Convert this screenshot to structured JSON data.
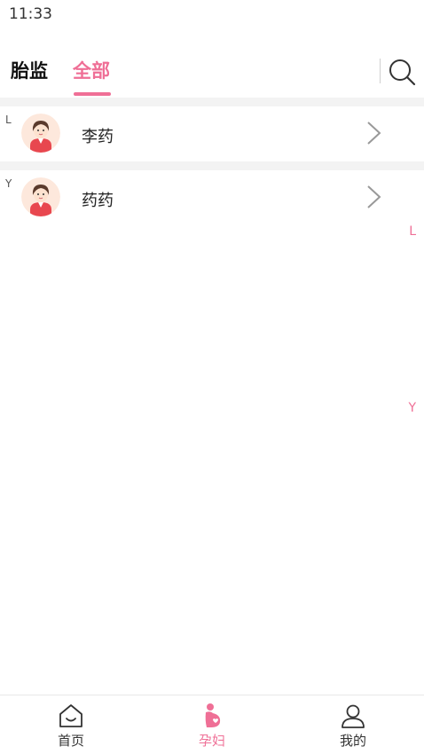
{
  "status_bar": {
    "time": "11:33"
  },
  "header": {
    "tabs": [
      {
        "label": "胎监",
        "active": false
      },
      {
        "label": "全部",
        "active": true
      }
    ],
    "search_icon": "search-icon"
  },
  "contacts": [
    {
      "group": "L",
      "name": "李药",
      "avatar_icon": "female-avatar-icon"
    },
    {
      "group": "Y",
      "name": "药药",
      "avatar_icon": "female-avatar-icon"
    }
  ],
  "index_bar": [
    "L",
    "Y"
  ],
  "bottom_nav": {
    "items": [
      {
        "label": "首页",
        "icon": "home-icon",
        "active": false
      },
      {
        "label": "孕妇",
        "icon": "pregnant-woman-icon",
        "active": true
      },
      {
        "label": "我的",
        "icon": "user-icon",
        "active": false
      }
    ]
  },
  "colors": {
    "accent": "#ef6f96",
    "separator": "#f3f3f3",
    "text": "#222222"
  }
}
